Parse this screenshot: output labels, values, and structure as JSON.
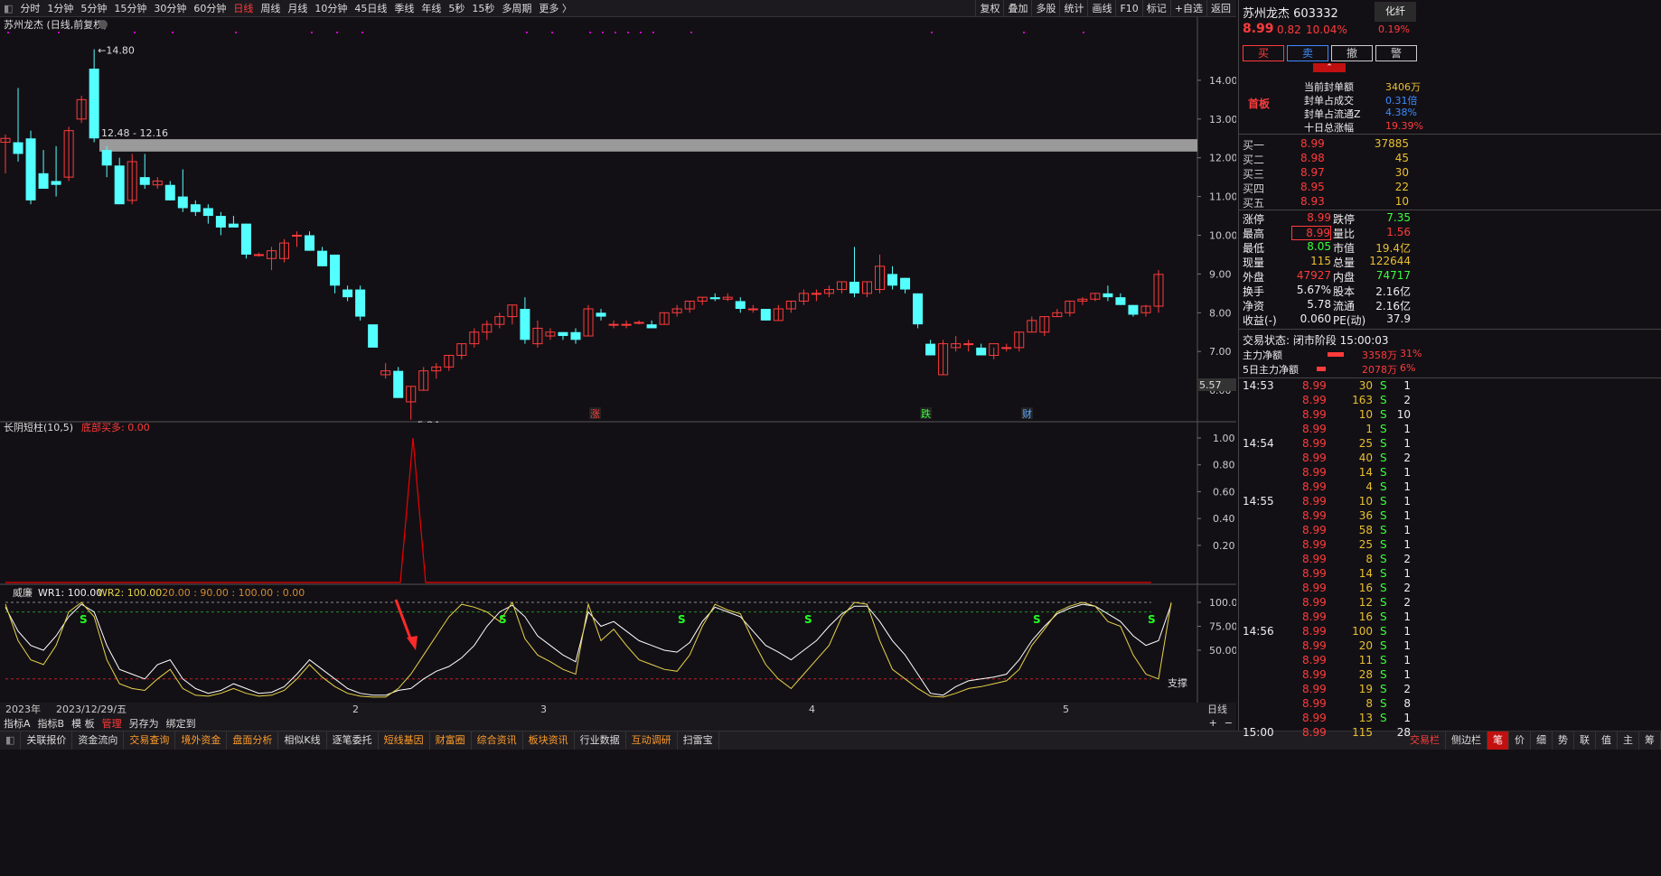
{
  "toolbar": {
    "periods": [
      "分时",
      "1分钟",
      "5分钟",
      "15分钟",
      "30分钟",
      "60分钟",
      "日线",
      "周线",
      "月线",
      "10分钟",
      "45日线",
      "季线",
      "年线",
      "5秒",
      "15秒",
      "多周期",
      "更多 〉"
    ],
    "active": "日线",
    "right": [
      "复权",
      "叠加",
      "多股",
      "统计",
      "画线",
      "F10",
      "标记",
      "+自选",
      "返回"
    ]
  },
  "main": {
    "title": "苏州龙杰 (日线,前复权)",
    "yticks": [
      "14.00",
      "13.00",
      "12.00",
      "11.00",
      "10.00",
      "9.00",
      "8.00",
      "7.00",
      "6.00"
    ],
    "high_label": "14.80",
    "low_label": "5.24",
    "zone_label": "12.48 - 12.16",
    "cursor_price": "5.57",
    "markers": [
      "涨",
      "跌",
      "财"
    ]
  },
  "ind1": {
    "name": "长阴短柱(10,5)",
    "value_label": "底部买多: 0.00",
    "yticks": [
      "1.00",
      "0.80",
      "0.60",
      "0.40",
      "0.20"
    ]
  },
  "ind2": {
    "name": "威廉",
    "wr1": "WR1: 100.00",
    "wr2": "WR2: 100.00",
    "extra": ": 20.00 : 90.00 : 100.00 : 0.00",
    "yticks": [
      "100.0",
      "75.00",
      "50.00"
    ],
    "support": "支撑",
    "s_marker": "S"
  },
  "xaxis": {
    "labels": [
      "2023年",
      "2023/12/29/五",
      "2",
      "3",
      "4",
      "5"
    ],
    "period": "日线"
  },
  "tabs": [
    "指标A",
    "指标B",
    "模 板",
    "管理",
    "另存为",
    "绑定到"
  ],
  "tab_active": "管理",
  "bottom": {
    "items": [
      "关联报价",
      "资金流向",
      "交易查询",
      "境外资金",
      "盘面分析",
      "相似K线",
      "逐笔委托",
      "短线基因",
      "财富圈",
      "综合资讯",
      "板块资讯",
      "行业数据",
      "互动调研",
      "扫雷宝"
    ],
    "right": [
      "交易栏",
      "侧边栏"
    ],
    "sidetabs": [
      "笔",
      "价",
      "细",
      "势",
      "联",
      "值",
      "主",
      "筹"
    ]
  },
  "side": {
    "name": "苏州龙杰",
    "code": "603332",
    "tag": "化纤",
    "price": "8.99",
    "chg": "0.82",
    "pct": "10.04%",
    "tagpct": "0.19%",
    "actions": [
      "买",
      "卖",
      "撤",
      "警"
    ],
    "first_board": "首板",
    "seal": [
      [
        "当前封单额",
        "3406万"
      ],
      [
        "封单占成交",
        "0.31倍"
      ],
      [
        "封单占流通Z",
        "4.38%"
      ],
      [
        "十日总涨幅",
        "19.39%"
      ]
    ],
    "bids": [
      [
        "买一",
        "8.99",
        "37885"
      ],
      [
        "买二",
        "8.98",
        "45"
      ],
      [
        "买三",
        "8.97",
        "30"
      ],
      [
        "买四",
        "8.95",
        "22"
      ],
      [
        "买五",
        "8.93",
        "10"
      ]
    ],
    "stats": [
      [
        "涨停",
        "8.99",
        "跌停",
        "7.35"
      ],
      [
        "最高",
        "8.99",
        "量比",
        "1.56"
      ],
      [
        "最低",
        "8.05",
        "市值",
        "19.4亿"
      ],
      [
        "现量",
        "115",
        "总量",
        "122644"
      ],
      [
        "外盘",
        "47927",
        "内盘",
        "74717"
      ],
      [
        "换手",
        "5.67%",
        "股本",
        "2.16亿"
      ],
      [
        "净资",
        "5.78",
        "流通",
        "2.16亿"
      ],
      [
        "收益(-)",
        "0.060",
        "PE(动)",
        "37.9"
      ]
    ],
    "status": "交易状态: 闭市阶段 15:00:03",
    "flow": [
      [
        "主力净额",
        "3358万",
        "31%"
      ],
      [
        "5日主力净额",
        "2078万",
        "6%"
      ]
    ],
    "ticks": [
      [
        "14:53",
        "8.99",
        "30",
        "S",
        "1"
      ],
      [
        "",
        "8.99",
        "163",
        "S",
        "2"
      ],
      [
        "",
        "8.99",
        "10",
        "S",
        "10"
      ],
      [
        "",
        "8.99",
        "1",
        "S",
        "1"
      ],
      [
        "14:54",
        "8.99",
        "25",
        "S",
        "1"
      ],
      [
        "",
        "8.99",
        "40",
        "S",
        "2"
      ],
      [
        "",
        "8.99",
        "14",
        "S",
        "1"
      ],
      [
        "",
        "8.99",
        "4",
        "S",
        "1"
      ],
      [
        "14:55",
        "8.99",
        "10",
        "S",
        "1"
      ],
      [
        "",
        "8.99",
        "36",
        "S",
        "1"
      ],
      [
        "",
        "8.99",
        "58",
        "S",
        "1"
      ],
      [
        "",
        "8.99",
        "25",
        "S",
        "1"
      ],
      [
        "",
        "8.99",
        "8",
        "S",
        "2"
      ],
      [
        "",
        "8.99",
        "14",
        "S",
        "1"
      ],
      [
        "",
        "8.99",
        "16",
        "S",
        "2"
      ],
      [
        "",
        "8.99",
        "12",
        "S",
        "2"
      ],
      [
        "",
        "8.99",
        "16",
        "S",
        "1"
      ],
      [
        "14:56",
        "8.99",
        "100",
        "S",
        "1"
      ],
      [
        "",
        "8.99",
        "20",
        "S",
        "1"
      ],
      [
        "",
        "8.99",
        "11",
        "S",
        "1"
      ],
      [
        "",
        "8.99",
        "28",
        "S",
        "1"
      ],
      [
        "",
        "8.99",
        "19",
        "S",
        "2"
      ],
      [
        "",
        "8.99",
        "8",
        "S",
        "8"
      ],
      [
        "",
        "8.99",
        "13",
        "S",
        "1"
      ],
      [
        "15:00",
        "8.99",
        "115",
        "",
        "28"
      ]
    ]
  },
  "candles": [
    [
      12.4,
      12.6,
      11.6,
      12.5
    ],
    [
      12.4,
      13.8,
      11.9,
      12.1
    ],
    [
      12.5,
      12.7,
      10.8,
      10.9
    ],
    [
      11.6,
      12.2,
      11.2,
      11.2
    ],
    [
      11.4,
      12.3,
      11.0,
      11.3
    ],
    [
      11.5,
      12.8,
      11.4,
      12.7
    ],
    [
      13.0,
      13.6,
      12.9,
      13.5
    ],
    [
      14.3,
      14.8,
      12.4,
      12.5
    ],
    [
      12.2,
      12.3,
      11.5,
      11.8
    ],
    [
      11.8,
      12.0,
      10.8,
      10.8
    ],
    [
      10.9,
      12.1,
      10.8,
      11.9
    ],
    [
      11.5,
      12.1,
      11.2,
      11.3
    ],
    [
      11.3,
      11.5,
      11.2,
      11.4
    ],
    [
      11.3,
      11.4,
      10.9,
      10.9
    ],
    [
      11.0,
      11.7,
      10.6,
      10.7
    ],
    [
      10.8,
      10.9,
      10.5,
      10.6
    ],
    [
      10.7,
      10.8,
      10.3,
      10.5
    ],
    [
      10.5,
      10.6,
      10.0,
      10.2
    ],
    [
      10.3,
      10.5,
      10.2,
      10.2
    ],
    [
      10.3,
      10.3,
      9.4,
      9.5
    ],
    [
      9.5,
      9.55,
      9.45,
      9.5
    ],
    [
      9.4,
      9.7,
      9.1,
      9.6
    ],
    [
      9.4,
      9.9,
      9.3,
      9.8
    ],
    [
      10.0,
      10.1,
      9.7,
      10.0
    ],
    [
      10.0,
      10.1,
      9.6,
      9.6
    ],
    [
      9.6,
      9.7,
      9.2,
      9.2
    ],
    [
      9.5,
      9.5,
      8.5,
      8.7
    ],
    [
      8.6,
      8.7,
      8.3,
      8.4
    ],
    [
      8.6,
      8.7,
      7.8,
      7.9
    ],
    [
      7.7,
      7.7,
      7.1,
      7.1
    ],
    [
      6.4,
      6.7,
      6.3,
      6.5
    ],
    [
      6.5,
      6.6,
      5.8,
      5.8
    ],
    [
      5.7,
      6.1,
      5.24,
      6.1
    ],
    [
      6.0,
      6.6,
      6.0,
      6.5
    ],
    [
      6.5,
      6.7,
      6.3,
      6.6
    ],
    [
      6.6,
      6.9,
      6.5,
      6.9
    ],
    [
      6.9,
      7.2,
      6.8,
      7.2
    ],
    [
      7.2,
      7.6,
      7.1,
      7.5
    ],
    [
      7.5,
      7.8,
      7.3,
      7.7
    ],
    [
      7.7,
      8.0,
      7.6,
      7.9
    ],
    [
      7.9,
      8.2,
      7.7,
      8.2
    ],
    [
      8.1,
      8.4,
      7.2,
      7.3
    ],
    [
      7.2,
      7.8,
      7.1,
      7.6
    ],
    [
      7.4,
      7.6,
      7.3,
      7.5
    ],
    [
      7.5,
      7.5,
      7.3,
      7.4
    ],
    [
      7.5,
      7.6,
      7.2,
      7.3
    ],
    [
      7.4,
      8.2,
      7.4,
      8.1
    ],
    [
      8.0,
      8.1,
      7.8,
      7.9
    ],
    [
      7.7,
      7.8,
      7.6,
      7.7
    ],
    [
      7.7,
      7.8,
      7.6,
      7.7
    ],
    [
      7.75,
      7.8,
      7.7,
      7.75
    ],
    [
      7.7,
      7.8,
      7.6,
      7.6
    ],
    [
      7.7,
      8.0,
      7.7,
      8.0
    ],
    [
      8.0,
      8.2,
      7.9,
      8.1
    ],
    [
      8.1,
      8.3,
      8.0,
      8.3
    ],
    [
      8.3,
      8.4,
      8.2,
      8.4
    ],
    [
      8.4,
      8.5,
      8.3,
      8.35
    ],
    [
      8.35,
      8.5,
      8.3,
      8.4
    ],
    [
      8.3,
      8.4,
      8.0,
      8.1
    ],
    [
      8.1,
      8.2,
      8.0,
      8.1
    ],
    [
      8.1,
      8.1,
      7.8,
      7.8
    ],
    [
      7.8,
      8.2,
      7.8,
      8.1
    ],
    [
      8.1,
      8.3,
      8.0,
      8.3
    ],
    [
      8.3,
      8.6,
      8.2,
      8.5
    ],
    [
      8.5,
      8.6,
      8.3,
      8.5
    ],
    [
      8.5,
      8.7,
      8.4,
      8.6
    ],
    [
      8.6,
      8.8,
      8.5,
      8.8
    ],
    [
      8.8,
      9.7,
      8.4,
      8.5
    ],
    [
      8.5,
      8.8,
      8.4,
      8.8
    ],
    [
      8.6,
      9.5,
      8.5,
      9.2
    ],
    [
      9.0,
      9.2,
      8.6,
      8.7
    ],
    [
      8.9,
      8.9,
      8.5,
      8.6
    ],
    [
      8.5,
      8.5,
      7.6,
      7.7
    ],
    [
      7.2,
      7.3,
      6.9,
      6.9
    ],
    [
      6.4,
      7.3,
      6.4,
      7.2
    ],
    [
      7.1,
      7.4,
      7.0,
      7.2
    ],
    [
      7.2,
      7.3,
      7.0,
      7.2
    ],
    [
      7.1,
      7.2,
      6.9,
      6.9
    ],
    [
      6.9,
      7.1,
      6.8,
      7.2
    ],
    [
      7.1,
      7.2,
      7.0,
      7.1
    ],
    [
      7.1,
      7.5,
      7.0,
      7.5
    ],
    [
      7.5,
      7.9,
      7.5,
      7.8
    ],
    [
      7.5,
      7.9,
      7.4,
      7.9
    ],
    [
      7.9,
      8.1,
      7.9,
      8.0
    ],
    [
      8.0,
      8.3,
      7.9,
      8.3
    ],
    [
      8.3,
      8.4,
      8.2,
      8.35
    ],
    [
      8.35,
      8.5,
      8.3,
      8.5
    ],
    [
      8.5,
      8.7,
      8.3,
      8.4
    ],
    [
      8.4,
      8.5,
      8.2,
      8.2
    ],
    [
      8.2,
      8.2,
      7.9,
      7.95
    ],
    [
      8.0,
      8.2,
      7.9,
      8.17
    ],
    [
      8.17,
      9.1,
      8.0,
      8.99
    ]
  ],
  "colors": {
    "up": "#ff3b3b",
    "down": "#54ffff",
    "bg": "#131015",
    "grid": "#3a3a3a"
  }
}
